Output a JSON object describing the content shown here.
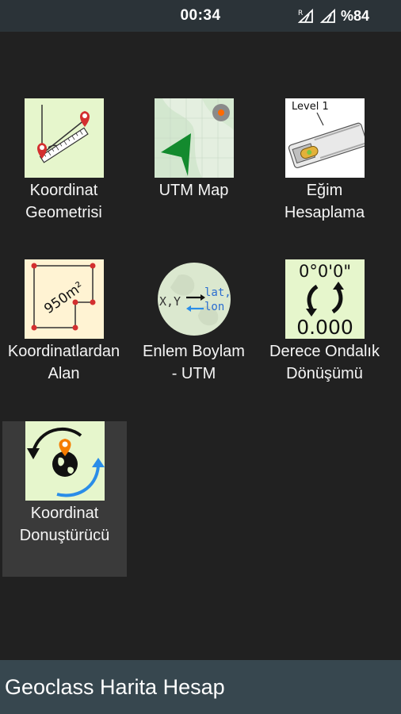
{
  "status_bar": {
    "time": "00:34",
    "roaming_indicator": "R",
    "battery_text": "%84",
    "icons": [
      "signal-roaming-icon",
      "signal-icon"
    ]
  },
  "tiles": [
    {
      "label": "Koordinat\nGeometrisi",
      "icon": "coordinate-geometry-icon"
    },
    {
      "label": "UTM Map",
      "icon": "utm-map-icon"
    },
    {
      "label": "Eğim\nHesaplama",
      "icon": "slope-level-icon",
      "icon_text": "Level 1"
    },
    {
      "label": "Koordinatlardan\nAlan",
      "icon": "area-from-coordinates-icon",
      "icon_text": "950m²"
    },
    {
      "label": "Enlem Boylam\n- UTM",
      "icon": "latlon-utm-icon",
      "icon_text": [
        "X,Y",
        "lat,",
        "lon"
      ]
    },
    {
      "label": "Derece Ondalık\nDönüşümü",
      "icon": "degree-decimal-icon",
      "icon_text": [
        "0°0'0\"",
        "0.000"
      ]
    },
    {
      "label": "Koordinat\nDonuştürücü",
      "icon": "coordinate-converter-icon",
      "selected": true
    }
  ],
  "bottom_bar": {
    "title": "Geoclass Harita Hesap"
  },
  "colors": {
    "background": "#212121",
    "status_bar": "#2b3338",
    "bottom_bar": "#37474f",
    "icon_bg": "#e6f6cc",
    "selected_tile": "#3a3a3a"
  }
}
